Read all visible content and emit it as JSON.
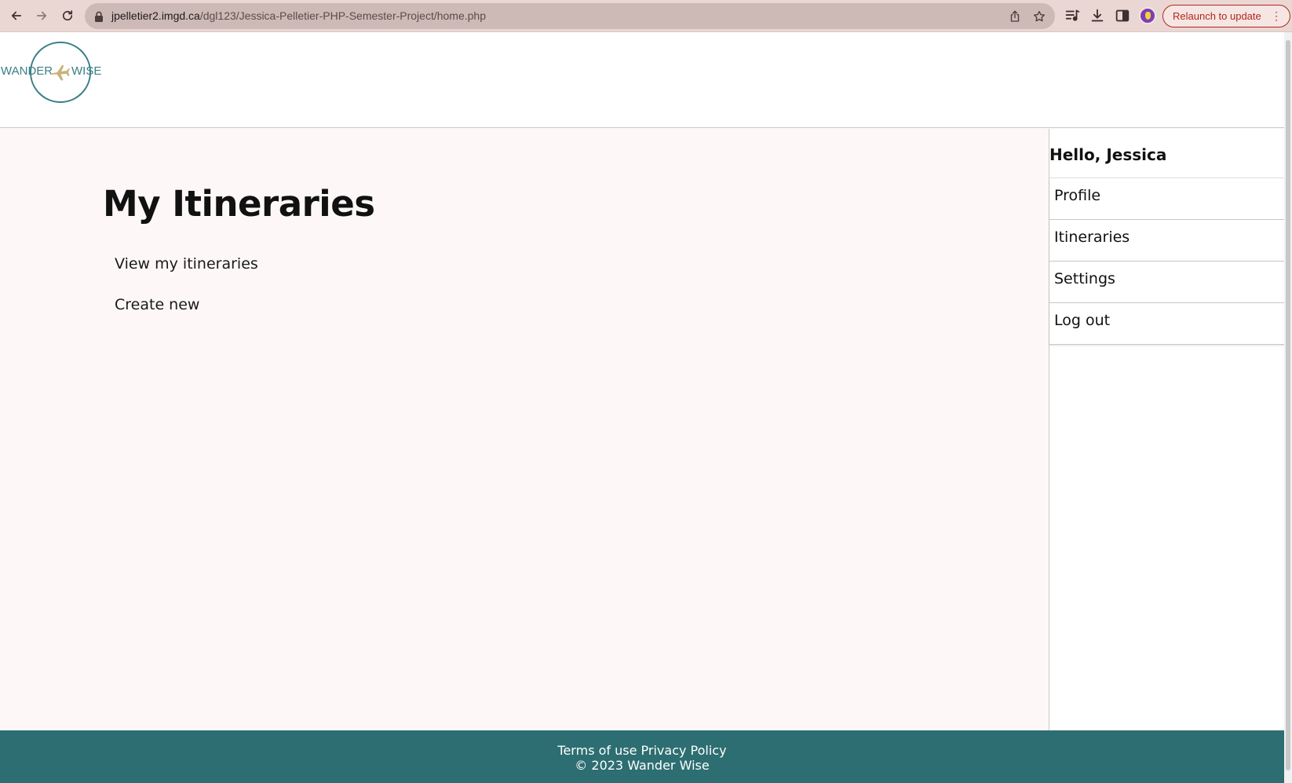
{
  "browser": {
    "url_host": "jpelletier2.imgd.ca",
    "url_path": "/dgl123/Jessica-Pelletier-PHP-Semester-Project/home.php",
    "relaunch_label": "Relaunch to update",
    "relaunch_menu": "⋮",
    "icons": [
      "back-arrow-icon",
      "forward-arrow-icon",
      "reload-icon",
      "lock-icon",
      "share-icon",
      "star-icon",
      "media-icon",
      "download-icon",
      "side-panel-icon",
      "profile-avatar"
    ]
  },
  "header": {
    "logo_left": "WANDER",
    "logo_right": "WISE",
    "logo_icon": "airplane-icon",
    "colors": {
      "logo_teal": "#3a7f86",
      "logo_plane": "#c9b27a"
    }
  },
  "main": {
    "title": "My Itineraries",
    "links": {
      "view": "View my itineraries",
      "create": "Create new"
    }
  },
  "sidebar": {
    "greeting": "Hello, Jessica",
    "items": [
      {
        "label": "Profile"
      },
      {
        "label": "Itineraries"
      },
      {
        "label": "Settings"
      },
      {
        "label": "Log out"
      }
    ]
  },
  "footer": {
    "terms": "Terms of use",
    "privacy": "Privacy Policy",
    "copyright": "© 2023 Wander Wise",
    "color": "#2d6e72"
  }
}
